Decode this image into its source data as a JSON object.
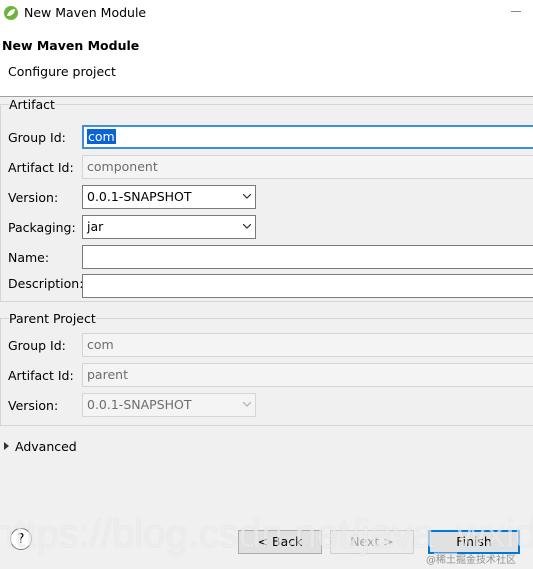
{
  "window": {
    "title": "New Maven Module"
  },
  "banner": {
    "title": "New Maven Module",
    "message": "Configure project"
  },
  "artifact": {
    "group_label": "Artifact",
    "group_id_label": "Group Id:",
    "group_id_value": "com",
    "artifact_id_label": "Artifact Id:",
    "artifact_id_value": "component",
    "version_label": "Version:",
    "version_value": "0.0.1-SNAPSHOT",
    "packaging_label": "Packaging:",
    "packaging_value": "jar",
    "name_label": "Name:",
    "name_value": "",
    "description_label": "Description:",
    "description_value": ""
  },
  "parent": {
    "group_label": "Parent Project",
    "group_id_label": "Group Id:",
    "group_id_value": "com",
    "artifact_id_label": "Artifact Id:",
    "artifact_id_value": "parent",
    "version_label": "Version:",
    "version_value": "0.0.1-SNAPSHOT"
  },
  "advanced": {
    "label": "Advanced"
  },
  "buttons": {
    "help": "?",
    "back": "< Back",
    "next": "Next >",
    "finish": "Finish"
  },
  "watermark": {
    "url": "https://blog.csdn.net/java_wxid",
    "site": "@稀土掘金技术社区"
  },
  "colors": {
    "accent": "#0078d7",
    "selection": "#0a64d6",
    "spring_green": "#6db33f"
  }
}
